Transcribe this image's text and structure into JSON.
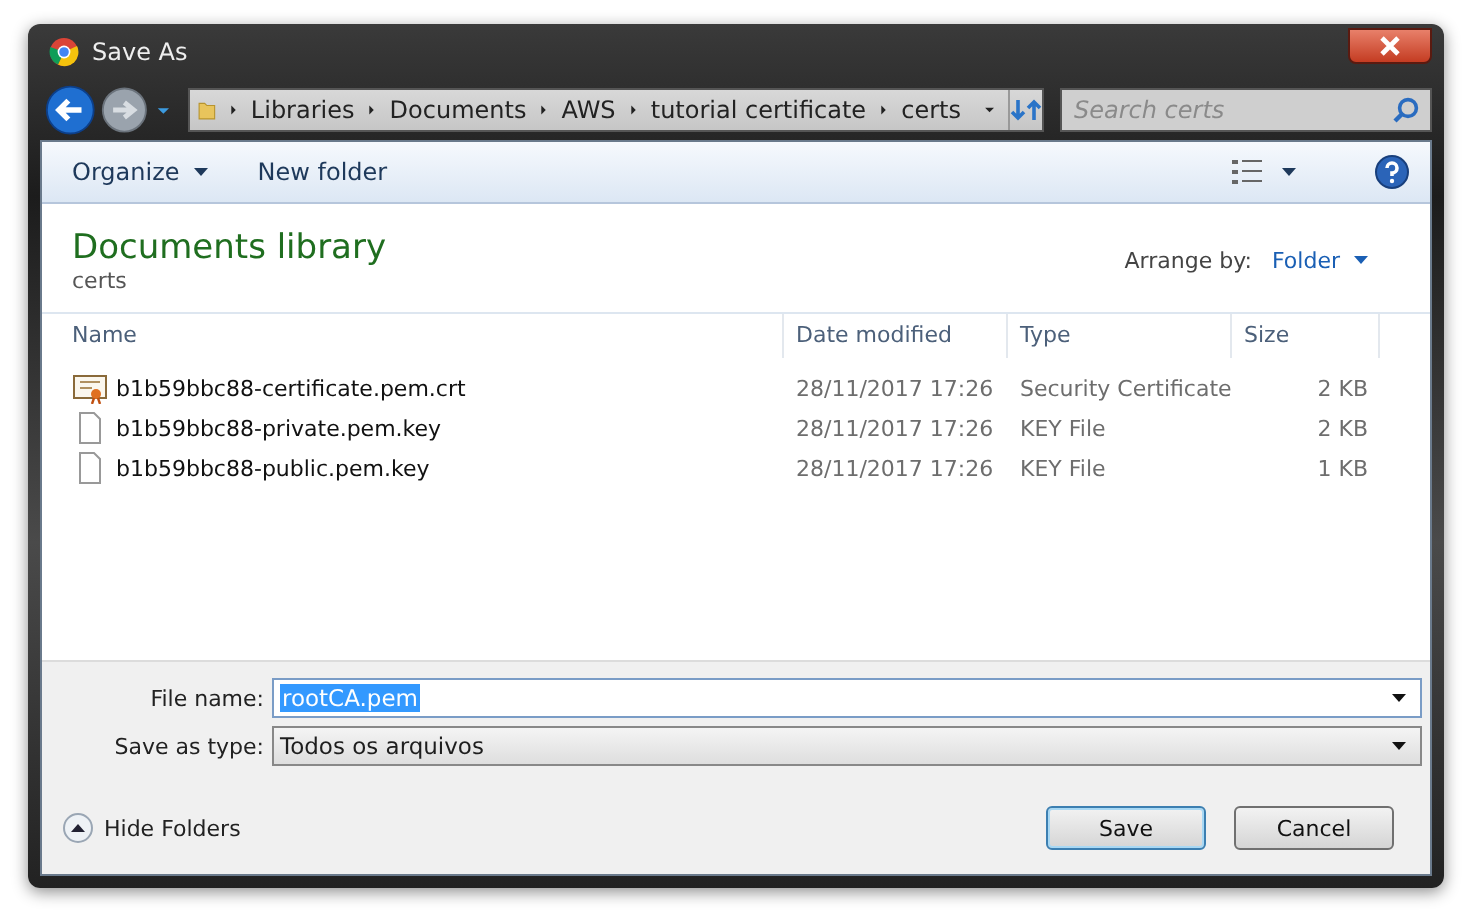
{
  "window": {
    "title": "Save As"
  },
  "breadcrumb": [
    "Libraries",
    "Documents",
    "AWS",
    "tutorial certificate",
    "certs"
  ],
  "search": {
    "placeholder": "Search certs"
  },
  "toolbar": [
    {
      "label": "Organize",
      "dropdown": true
    },
    {
      "label": "New folder",
      "dropdown": false
    }
  ],
  "library": {
    "title": "Documents library",
    "subtitle": "certs",
    "arrange_label": "Arrange by:",
    "arrange_value": "Folder"
  },
  "columns": [
    "Name",
    "Date modified",
    "Type",
    "Size"
  ],
  "rows": [
    {
      "kind": "certificate",
      "name": "b1b59bbc88-certificate.pem.crt",
      "date": "28/11/2017 17:26",
      "type": "Security Certificate",
      "size": "2 KB"
    },
    {
      "kind": "file",
      "name": "b1b59bbc88-private.pem.key",
      "date": "28/11/2017 17:26",
      "type": "KEY File",
      "size": "2 KB"
    },
    {
      "kind": "file",
      "name": "b1b59bbc88-public.pem.key",
      "date": "28/11/2017 17:26",
      "type": "KEY File",
      "size": "1 KB"
    }
  ],
  "file_name": {
    "label": "File name:",
    "value": "rootCA.pem",
    "selected": true
  },
  "save_type": {
    "label": "Save as type:",
    "value": "Todos os arquivos"
  },
  "hide_folders": "Hide Folders",
  "buttons": [
    {
      "label": "Save",
      "default": true
    },
    {
      "label": "Cancel",
      "default": false
    }
  ]
}
